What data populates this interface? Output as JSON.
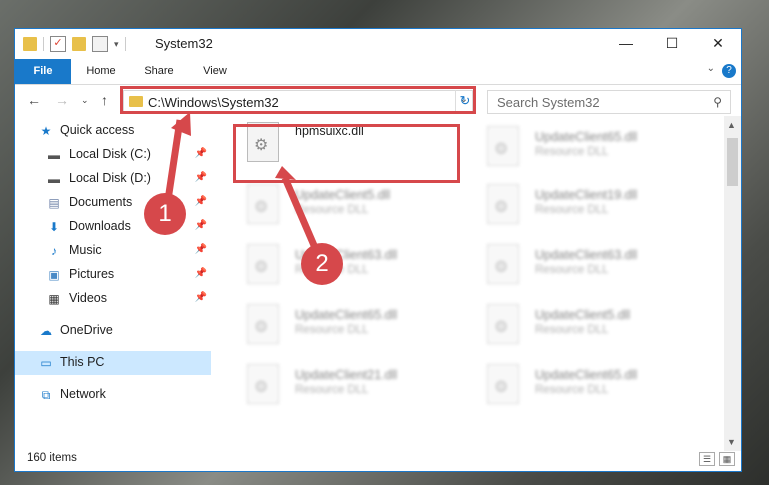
{
  "window": {
    "title": "System32",
    "controls": {
      "minimize": "—",
      "maximize": "☐",
      "close": "✕"
    }
  },
  "ribbon": {
    "tabs": [
      "File",
      "Home",
      "Share",
      "View"
    ],
    "help": "?"
  },
  "address": {
    "path": "C:\\Windows\\System32",
    "search_placeholder": "Search System32"
  },
  "sidebar": {
    "items": [
      {
        "label": "Quick access",
        "icon": "star-icon",
        "pinned": false
      },
      {
        "label": "Local Disk (C:)",
        "icon": "drive-icon",
        "pinned": true
      },
      {
        "label": "Local Disk (D:)",
        "icon": "drive-icon",
        "pinned": true
      },
      {
        "label": "Documents",
        "icon": "documents-icon",
        "pinned": true
      },
      {
        "label": "Downloads",
        "icon": "download-icon",
        "pinned": true
      },
      {
        "label": "Music",
        "icon": "music-icon",
        "pinned": true
      },
      {
        "label": "Pictures",
        "icon": "pictures-icon",
        "pinned": true
      },
      {
        "label": "Videos",
        "icon": "videos-icon",
        "pinned": true
      },
      {
        "label": "OneDrive",
        "icon": "cloud-icon",
        "pinned": false
      },
      {
        "label": "This PC",
        "icon": "computer-icon",
        "pinned": false,
        "selected": true
      },
      {
        "label": "Network",
        "icon": "network-icon",
        "pinned": false
      }
    ]
  },
  "files": {
    "highlighted": {
      "name": "hpmsuixc.dll"
    },
    "left_blurred": [
      {
        "name": "UpdateClient5.dll",
        "type": "Resource DLL"
      },
      {
        "name": "UpdateClient63.dll",
        "type": "Resource DLL"
      },
      {
        "name": "UpdateClient65.dll",
        "type": "Resource DLL"
      },
      {
        "name": "UpdateClient21.dll",
        "type": "Resource DLL"
      }
    ],
    "right_blurred": [
      {
        "name": "UpdateClient65.dll",
        "type": "Resource DLL"
      },
      {
        "name": "UpdateClient19.dll",
        "type": "Resource DLL"
      },
      {
        "name": "UpdateClient63.dll",
        "type": "Resource DLL"
      },
      {
        "name": "UpdateClient5.dll",
        "type": "Resource DLL"
      },
      {
        "name": "UpdateClient65.dll",
        "type": "Resource DLL"
      }
    ]
  },
  "status": {
    "count": "160 items"
  },
  "annotations": {
    "step1": "1",
    "step2": "2",
    "color": "#d6484b"
  },
  "colors": {
    "accent": "#1979ca",
    "selection": "#cce8ff"
  }
}
